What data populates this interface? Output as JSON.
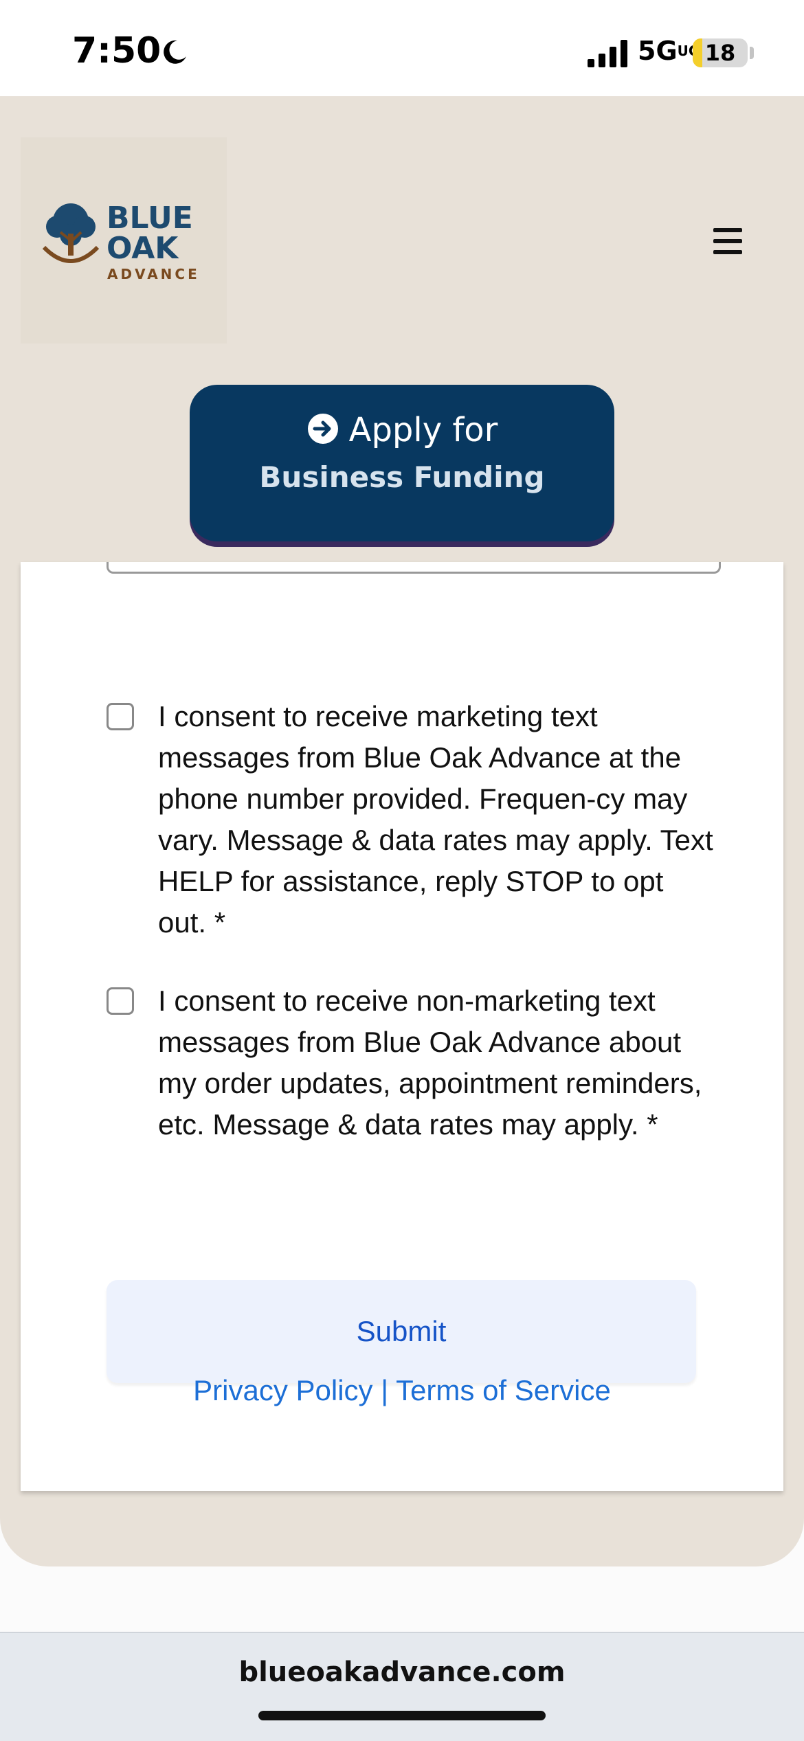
{
  "status_bar": {
    "time": "7:50",
    "network": "5G",
    "network_suffix": "UC",
    "battery_level": "18",
    "battery_fraction": 0.18
  },
  "header": {
    "logo": {
      "line1": "BLUE",
      "line2": "OAK",
      "line3": "ADVANCE",
      "icon": "oak-tree-icon"
    },
    "menu_icon": "hamburger-menu-icon"
  },
  "apply_button": {
    "line1": "Apply for",
    "line2": "Business Funding",
    "icon": "arrow-right-circle-icon",
    "color": "#083860"
  },
  "form": {
    "consents": [
      {
        "text": "I consent to receive marketing text messages from Blue Oak Advance at the phone number provided. Frequen-cy may vary. Message & data rates may apply. Text HELP for assistance, reply STOP to opt out. *",
        "checked": false
      },
      {
        "text": "I consent to receive non-marketing text messages from Blue Oak Advance about my order updates, appointment reminders, etc. Message & data rates may apply. *",
        "checked": false
      }
    ],
    "submit_label": "Submit",
    "footer": {
      "privacy": "Privacy Policy",
      "separator": "|",
      "terms": "Terms of Service"
    }
  },
  "browser": {
    "url": "blueoakadvance.com"
  },
  "colors": {
    "page_bg": "#e8e1d8",
    "brand_navy": "#083860",
    "link_blue": "#1d6fd6",
    "submit_bg": "#edf2fd"
  }
}
